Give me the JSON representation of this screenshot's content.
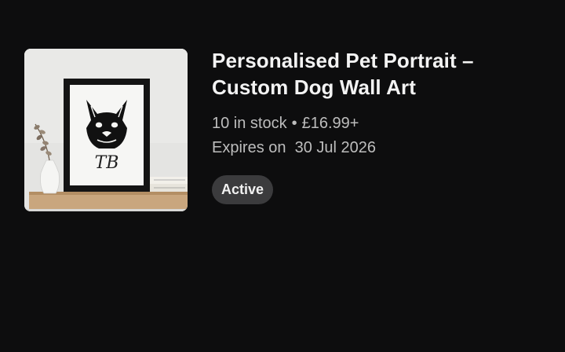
{
  "listing": {
    "title_line1": "Personalised Pet Portrait –",
    "title_line2": "Custom Dog Wall Art",
    "stock": "10 in stock",
    "separator": "•",
    "price": "£16.99+",
    "expires_label": "Expires on",
    "expires_date": "30 Jul 2026",
    "status": "Active",
    "image": {
      "icon": "framed-dog-portrait-photo",
      "frame_initials": "TB"
    }
  },
  "colors": {
    "background": "#0d0d0e",
    "title": "#f3f3f3",
    "meta_text": "#bdbdbd",
    "badge_bg": "#3b3b3d",
    "badge_text": "#f1f1f1"
  }
}
